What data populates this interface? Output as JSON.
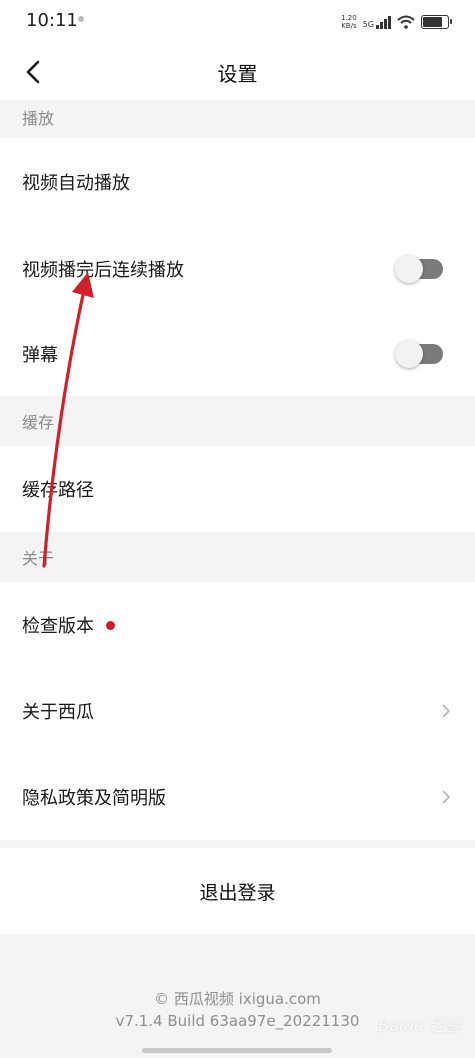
{
  "status_bar": {
    "time": "10:11",
    "net_speed_value": "1.20",
    "net_speed_unit": "KB/s",
    "network": "5G"
  },
  "header": {
    "title": "设置",
    "back_icon": "chevron-left-icon"
  },
  "sections": {
    "playback": {
      "title": "播放",
      "autoplay_label": "视频自动播放",
      "continuous_label": "视频播完后连续播放",
      "continuous_on": false,
      "danmaku_label": "弹幕",
      "danmaku_on": false
    },
    "cache": {
      "title": "缓存",
      "path_label": "缓存路径"
    },
    "about": {
      "title": "关于",
      "check_version_label": "检查版本",
      "about_app_label": "关于西瓜",
      "privacy_label": "隐私政策及简明版"
    }
  },
  "logout_label": "退出登录",
  "footer": {
    "copyright": "© 西瓜视频 ixigua.com",
    "version": "v7.1.4 Build 63aa97e_20221130"
  },
  "watermark": "Baidu 经验",
  "colors": {
    "accent_red": "#d01b28",
    "toggle_off": "#7a7a7a",
    "page_bg": "#f4f4f4"
  }
}
